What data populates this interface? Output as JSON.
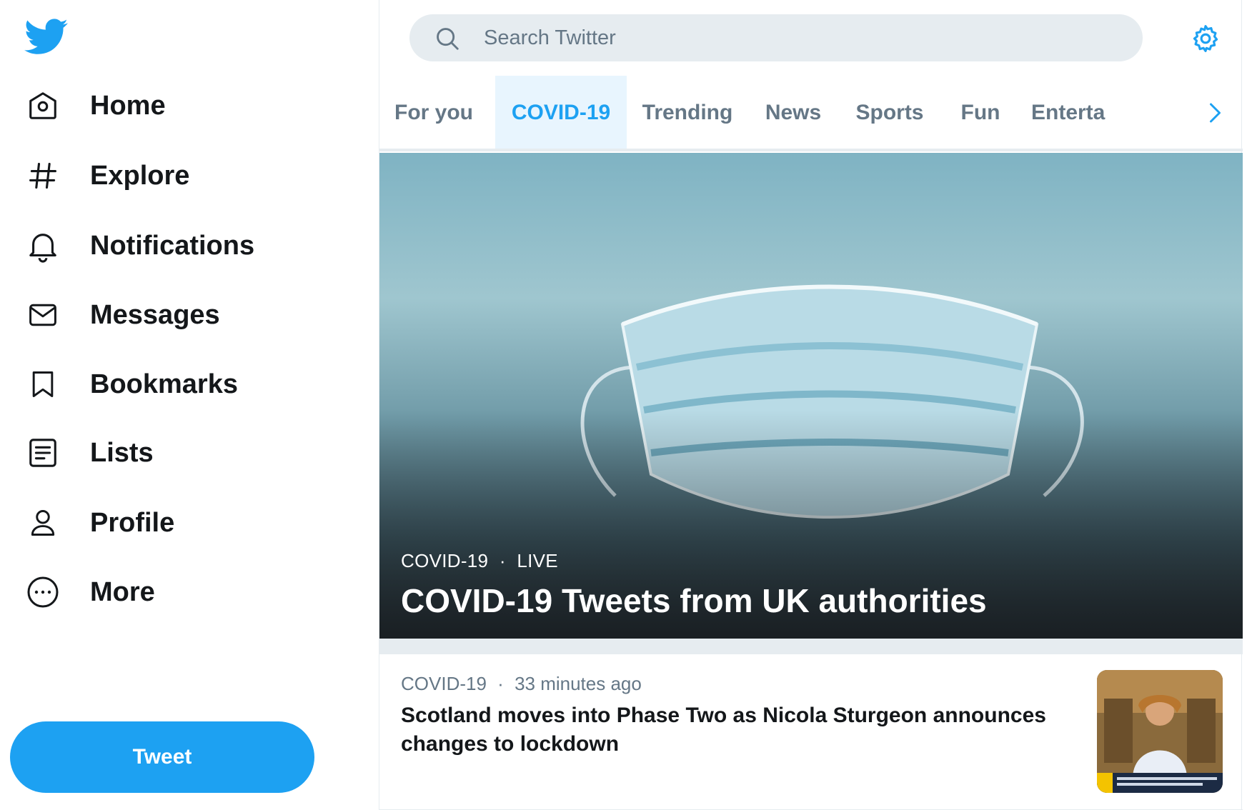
{
  "sidebar": {
    "nav": [
      {
        "label": "Home",
        "icon": "home-icon"
      },
      {
        "label": "Explore",
        "icon": "hashtag-icon"
      },
      {
        "label": "Notifications",
        "icon": "bell-icon"
      },
      {
        "label": "Messages",
        "icon": "envelope-icon"
      },
      {
        "label": "Bookmarks",
        "icon": "bookmark-icon"
      },
      {
        "label": "Lists",
        "icon": "list-icon"
      },
      {
        "label": "Profile",
        "icon": "person-icon"
      },
      {
        "label": "More",
        "icon": "more-circle-icon"
      }
    ],
    "tweet_label": "Tweet"
  },
  "search": {
    "placeholder": "Search Twitter"
  },
  "tabs": [
    {
      "label": "For you",
      "active": false
    },
    {
      "label": "COVID-19",
      "active": true
    },
    {
      "label": "Trending",
      "active": false
    },
    {
      "label": "News",
      "active": false
    },
    {
      "label": "Sports",
      "active": false
    },
    {
      "label": "Fun",
      "active": false
    },
    {
      "label": "Enterta",
      "active": false
    }
  ],
  "hero": {
    "category": "COVID-19",
    "separator": "·",
    "status": "LIVE",
    "title": "COVID-19 Tweets from UK authorities"
  },
  "story": {
    "category": "COVID-19",
    "separator": "·",
    "time": "33 minutes ago",
    "title": "Scotland moves into Phase Two as Nicola Sturgeon announces changes to lockdown"
  },
  "colors": {
    "accent": "#1da1f2",
    "text_primary": "#14171a",
    "text_secondary": "#657786",
    "border": "#e6ecf0"
  }
}
